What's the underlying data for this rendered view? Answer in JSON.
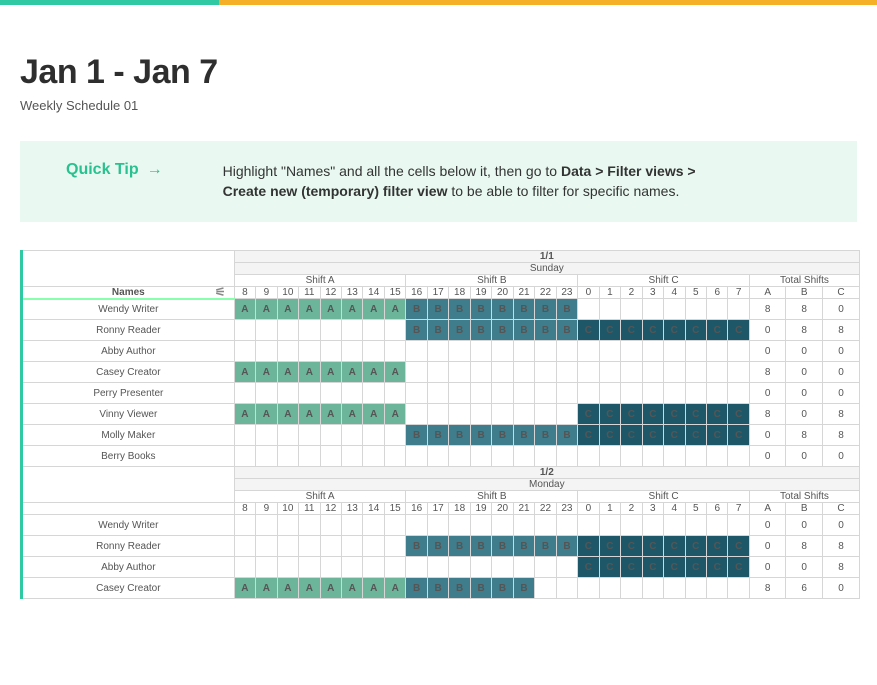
{
  "title": "Jan 1 - Jan 7",
  "subtitle": "Weekly Schedule 01",
  "tip": {
    "label": "Quick Tip",
    "text_before": "Highlight \"Names\" and all the cells below it, then go to ",
    "bold": "Data > Filter views > Create new (temporary) filter view",
    "text_after": " to be able to filter for specific names."
  },
  "shiftLabels": {
    "a": "Shift A",
    "b": "Shift B",
    "c": "Shift C",
    "total": "Total Shifts"
  },
  "hours": [
    "8",
    "9",
    "10",
    "11",
    "12",
    "13",
    "14",
    "15",
    "16",
    "17",
    "18",
    "19",
    "20",
    "21",
    "22",
    "23",
    "0",
    "1",
    "2",
    "3",
    "4",
    "5",
    "6",
    "7"
  ],
  "totalCols": [
    "A",
    "B",
    "C"
  ],
  "namesHeader": "Names",
  "days": [
    {
      "date": "1/1",
      "name": "Sunday",
      "rows": [
        {
          "name": "Wendy Writer",
          "shifts": [
            "A",
            "A",
            "A",
            "A",
            "A",
            "A",
            "A",
            "A",
            "B",
            "B",
            "B",
            "B",
            "B",
            "B",
            "B",
            "B",
            "",
            "",
            "",
            "",
            "",
            "",
            "",
            ""
          ],
          "totals": [
            8,
            8,
            0
          ]
        },
        {
          "name": "Ronny Reader",
          "shifts": [
            "",
            "",
            "",
            "",
            "",
            "",
            "",
            "",
            "B",
            "B",
            "B",
            "B",
            "B",
            "B",
            "B",
            "B",
            "C",
            "C",
            "C",
            "C",
            "C",
            "C",
            "C",
            "C"
          ],
          "totals": [
            0,
            8,
            8
          ]
        },
        {
          "name": "Abby Author",
          "shifts": [
            "",
            "",
            "",
            "",
            "",
            "",
            "",
            "",
            "",
            "",
            "",
            "",
            "",
            "",
            "",
            "",
            "",
            "",
            "",
            "",
            "",
            "",
            "",
            ""
          ],
          "totals": [
            0,
            0,
            0
          ]
        },
        {
          "name": "Casey Creator",
          "shifts": [
            "A",
            "A",
            "A",
            "A",
            "A",
            "A",
            "A",
            "A",
            "",
            "",
            "",
            "",
            "",
            "",
            "",
            "",
            "",
            "",
            "",
            "",
            "",
            "",
            "",
            ""
          ],
          "totals": [
            8,
            0,
            0
          ]
        },
        {
          "name": "Perry Presenter",
          "shifts": [
            "",
            "",
            "",
            "",
            "",
            "",
            "",
            "",
            "",
            "",
            "",
            "",
            "",
            "",
            "",
            "",
            "",
            "",
            "",
            "",
            "",
            "",
            "",
            ""
          ],
          "totals": [
            0,
            0,
            0
          ]
        },
        {
          "name": "Vinny Viewer",
          "shifts": [
            "A",
            "A",
            "A",
            "A",
            "A",
            "A",
            "A",
            "A",
            "",
            "",
            "",
            "",
            "",
            "",
            "",
            "",
            "C",
            "C",
            "C",
            "C",
            "C",
            "C",
            "C",
            "C"
          ],
          "totals": [
            8,
            0,
            8
          ]
        },
        {
          "name": "Molly Maker",
          "shifts": [
            "",
            "",
            "",
            "",
            "",
            "",
            "",
            "",
            "B",
            "B",
            "B",
            "B",
            "B",
            "B",
            "B",
            "B",
            "C",
            "C",
            "C",
            "C",
            "C",
            "C",
            "C",
            "C"
          ],
          "totals": [
            0,
            8,
            8
          ]
        },
        {
          "name": "Berry Books",
          "shifts": [
            "",
            "",
            "",
            "",
            "",
            "",
            "",
            "",
            "",
            "",
            "",
            "",
            "",
            "",
            "",
            "",
            "",
            "",
            "",
            "",
            "",
            "",
            "",
            ""
          ],
          "totals": [
            0,
            0,
            0
          ]
        }
      ]
    },
    {
      "date": "1/2",
      "name": "Monday",
      "rows": [
        {
          "name": "Wendy Writer",
          "shifts": [
            "",
            "",
            "",
            "",
            "",
            "",
            "",
            "",
            "",
            "",
            "",
            "",
            "",
            "",
            "",
            "",
            "",
            "",
            "",
            "",
            "",
            "",
            "",
            ""
          ],
          "totals": [
            0,
            0,
            0
          ]
        },
        {
          "name": "Ronny Reader",
          "shifts": [
            "",
            "",
            "",
            "",
            "",
            "",
            "",
            "",
            "B",
            "B",
            "B",
            "B",
            "B",
            "B",
            "B",
            "B",
            "C",
            "C",
            "C",
            "C",
            "C",
            "C",
            "C",
            "C"
          ],
          "totals": [
            0,
            8,
            8
          ]
        },
        {
          "name": "Abby Author",
          "shifts": [
            "",
            "",
            "",
            "",
            "",
            "",
            "",
            "",
            "",
            "",
            "",
            "",
            "",
            "",
            "",
            "",
            "C",
            "C",
            "C",
            "C",
            "C",
            "C",
            "C",
            "C"
          ],
          "totals": [
            0,
            0,
            8
          ]
        },
        {
          "name": "Casey Creator",
          "shifts": [
            "A",
            "A",
            "A",
            "A",
            "A",
            "A",
            "A",
            "A",
            "B",
            "B",
            "B",
            "B",
            "B",
            "B",
            "",
            "",
            "",
            "",
            "",
            "",
            "",
            "",
            "",
            ""
          ],
          "totals": [
            8,
            6,
            0
          ]
        }
      ]
    }
  ]
}
